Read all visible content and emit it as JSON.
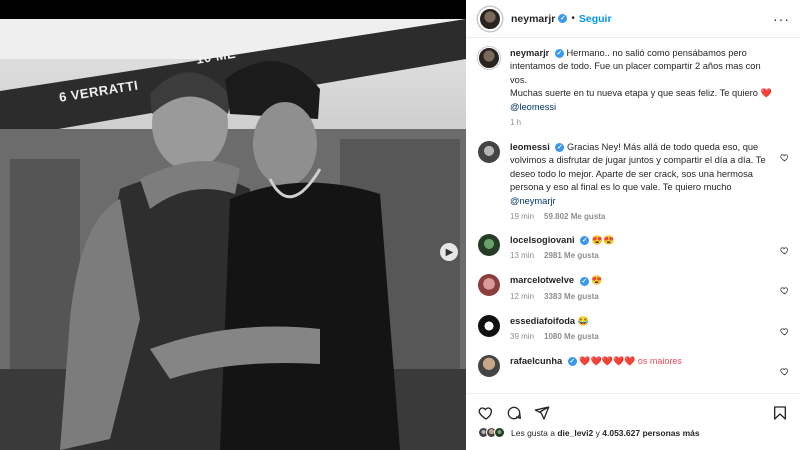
{
  "post": {
    "username": "neymarjr",
    "follow_label": "Seguir",
    "more_label": "···",
    "caption": {
      "username": "neymarjr",
      "line1": "Hermano.. no salió como pensábamos pero intentamos de todo. Fue un placer compartir 2 años mas con vos.",
      "line2": "Muchas suerte en tu nueva etapa y que seas feliz. Te quiero",
      "heart": "❤️",
      "mention": "@leomessi",
      "time": "1 h"
    },
    "image": {
      "jersey_names": [
        "6 VERRATTI",
        "10 ME"
      ]
    }
  },
  "comments": [
    {
      "username": "leomessi",
      "verified": true,
      "text": "Gracias Ney! Más allá de todo queda eso, que volvimos a disfrutar de jugar juntos y compartir el día a día. Te deseo todo lo mejor. Aparte de ser crack, sos una hermosa persona y eso al final es lo que vale. Te quiero mucho",
      "mention": "@neymarjr",
      "time": "19 min",
      "likes": "59.802 Me gusta"
    },
    {
      "username": "locelsogiovani",
      "verified": true,
      "text": "😍😍",
      "time": "13 min",
      "likes": "2981 Me gusta"
    },
    {
      "username": "marcelotwelve",
      "verified": true,
      "text": "😍",
      "time": "12 min",
      "likes": "3383 Me gusta"
    },
    {
      "username": "essediafoifoda",
      "verified": false,
      "text": "😂",
      "time": "39 min",
      "likes": "1080 Me gusta"
    },
    {
      "username": "rafaelcunha",
      "verified": true,
      "text": "❤️❤️❤️❤️❤️ os maiores"
    }
  ],
  "actions": {
    "icons": [
      "heart-icon",
      "comment-icon",
      "share-icon",
      "bookmark-icon"
    ]
  },
  "likes_summary": {
    "prefix": "Les gusta a",
    "user": "die_levi2",
    "middle": "y",
    "count": "4.053.627",
    "suffix": "personas más"
  },
  "colors": {
    "link_blue": "#0095f6",
    "verified_blue": "#3897f0",
    "mention_navy": "#00376b",
    "heart_red": "#ed4956"
  }
}
